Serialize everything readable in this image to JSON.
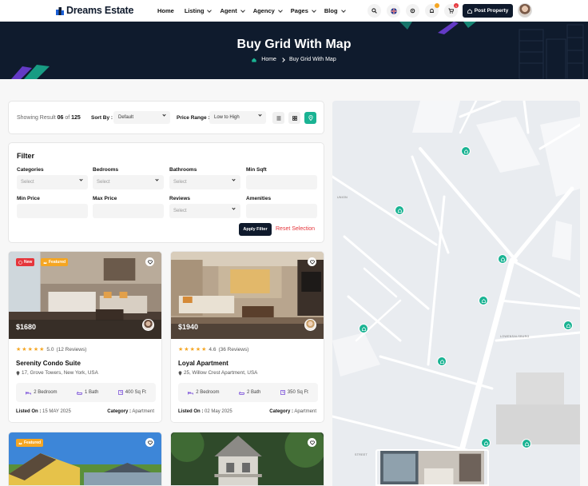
{
  "brand": {
    "name": "Dreams Estate"
  },
  "nav": [
    {
      "label": "Home",
      "caret": false
    },
    {
      "label": "Listing",
      "caret": true
    },
    {
      "label": "Agent",
      "caret": true
    },
    {
      "label": "Agency",
      "caret": true
    },
    {
      "label": "Pages",
      "caret": true
    },
    {
      "label": "Blog",
      "caret": true
    }
  ],
  "header": {
    "icons": [
      "search-icon",
      "language-flag-icon",
      "settings-icon",
      "notification-icon",
      "cart-icon"
    ],
    "cart_count": "1",
    "post_property_label": "Post Property"
  },
  "hero": {
    "title": "Buy Grid With Map",
    "breadcrumb": [
      "Home",
      "Buy Grid With Map"
    ]
  },
  "results": {
    "prefix": "Showing Result",
    "shown": "06",
    "of": "of",
    "total": "125",
    "sort_label": "Sort By :",
    "sort_value": "Default",
    "price_label": "Price Range :",
    "price_value": "Low to High",
    "view_modes": [
      "list-view-icon",
      "grid-view-icon",
      "map-view-icon"
    ]
  },
  "filter": {
    "title": "Filter",
    "fields": [
      {
        "label": "Categories",
        "value": "Select",
        "type": "select"
      },
      {
        "label": "Bedrooms",
        "value": "Select",
        "type": "select"
      },
      {
        "label": "Bathrooms",
        "value": "Select",
        "type": "select"
      },
      {
        "label": "Min Sqft",
        "value": "",
        "type": "input"
      },
      {
        "label": "Min Price",
        "value": "",
        "type": "input"
      },
      {
        "label": "Max Price",
        "value": "",
        "type": "input"
      },
      {
        "label": "Reviews",
        "value": "Select",
        "type": "select"
      },
      {
        "label": "Amenities",
        "value": "",
        "type": "input"
      }
    ],
    "apply_label": "Apply Filter",
    "reset_label": "Reset Selection"
  },
  "cards": [
    {
      "badges": [
        "New",
        "Featured"
      ],
      "price": "$1680",
      "rating": "5.0",
      "reviews": "(12 Reviews)",
      "title": "Serenity Condo Suite",
      "address": "17, Grove Towers, New York, USA",
      "features": [
        "2 Bedroom",
        "1 Bath",
        "400 Sq Ft"
      ],
      "listed_label": "Listed On :",
      "listed_date": "15 MAY 2025",
      "category_label": "Category :",
      "category": "Apartment"
    },
    {
      "badges": [],
      "price": "$1940",
      "rating": "4.6",
      "reviews": "(36 Reviews)",
      "title": "Loyal Apartment",
      "address": "25, Willow Crest Apartment, USA",
      "features": [
        "2 Bedroom",
        "2 Bath",
        "350 Sq Ft"
      ],
      "listed_label": "Listed On :",
      "listed_date": "02 May 2025",
      "category_label": "Category :",
      "category": "Apartment"
    },
    {
      "badges": [
        "Featured"
      ]
    },
    {
      "badges": []
    }
  ],
  "map": {
    "labels": [
      "UNION",
      "LOWENSALSBURG",
      "STREET"
    ]
  },
  "colors": {
    "accent": "#1ab393",
    "navy": "#0f1a2c",
    "danger": "#e5353b",
    "star": "#f5a623",
    "featured": "#f5a623"
  }
}
